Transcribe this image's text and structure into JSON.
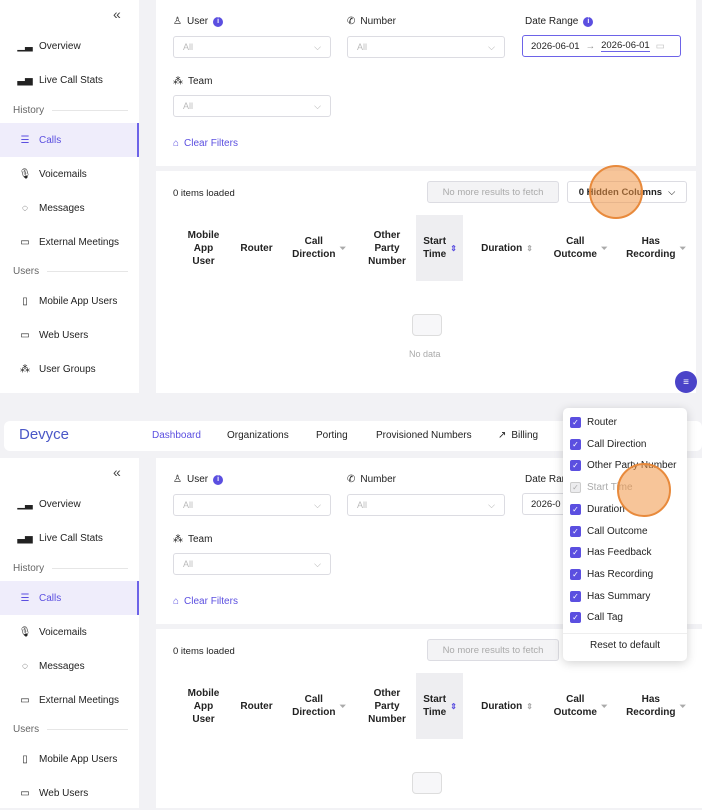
{
  "colors": {
    "accent": "#5b4fe0",
    "brand": "#4a57c7",
    "highlight": "#e88a3c"
  },
  "top": {
    "sidebar": {
      "collapse": "«",
      "items": [
        {
          "label": "Overview",
          "icon": "bar-chart-icon"
        },
        {
          "label": "Live Call Stats",
          "icon": "area-chart-icon"
        },
        {
          "label": "Calls",
          "icon": "list-icon",
          "active": true
        },
        {
          "label": "Voicemails",
          "icon": "microphone-icon"
        },
        {
          "label": "Messages",
          "icon": "chat-icon"
        },
        {
          "label": "External Meetings",
          "icon": "video-icon"
        },
        {
          "label": "Mobile App Users",
          "icon": "phone-icon"
        },
        {
          "label": "Web Users",
          "icon": "monitor-icon"
        },
        {
          "label": "User Groups",
          "icon": "group-icon"
        }
      ],
      "section_history": "History",
      "section_users": "Users"
    },
    "filters": {
      "user_label": "User",
      "number_label": "Number",
      "date_label": "Date Range",
      "team_label": "Team",
      "user_value": "All",
      "number_value": "All",
      "team_value": "All",
      "date_start": "2026-06-01",
      "date_arrow": "→",
      "date_end": "2026-06-01",
      "clear_filters": "Clear Filters"
    },
    "table": {
      "items_loaded": "0 items loaded",
      "no_more": "No more results to fetch",
      "hidden_columns": "0 Hidden Columns",
      "no_data": "No data",
      "columns": [
        {
          "label": "Mobile\nApp\nUser"
        },
        {
          "label": "Router"
        },
        {
          "label": "Call\nDirection"
        },
        {
          "label": "Other\nParty\nNumber"
        },
        {
          "label": "Start\nTime"
        },
        {
          "label": "Duration"
        },
        {
          "label": "Call\nOutcome"
        },
        {
          "label": "Has\nRecording"
        }
      ]
    }
  },
  "bottom": {
    "brand": "Devyce",
    "nav": [
      "Dashboard",
      "Organizations",
      "Porting",
      "Provisioned Numbers",
      "Billing"
    ],
    "date_partial_label": "Date Ran",
    "date_partial_value": "2026-0",
    "menu": {
      "items": [
        {
          "label": "Router",
          "checked": true
        },
        {
          "label": "Call Direction",
          "checked": true
        },
        {
          "label": "Other Party Number",
          "checked": true
        },
        {
          "label": "Start Time",
          "checked": true,
          "disabled": true
        },
        {
          "label": "Duration",
          "checked": true
        },
        {
          "label": "Call Outcome",
          "checked": true
        },
        {
          "label": "Has Feedback",
          "checked": true
        },
        {
          "label": "Has Recording",
          "checked": true
        },
        {
          "label": "Has Summary",
          "checked": true
        },
        {
          "label": "Call Tag",
          "checked": true
        }
      ],
      "reset": "Reset to default"
    }
  }
}
